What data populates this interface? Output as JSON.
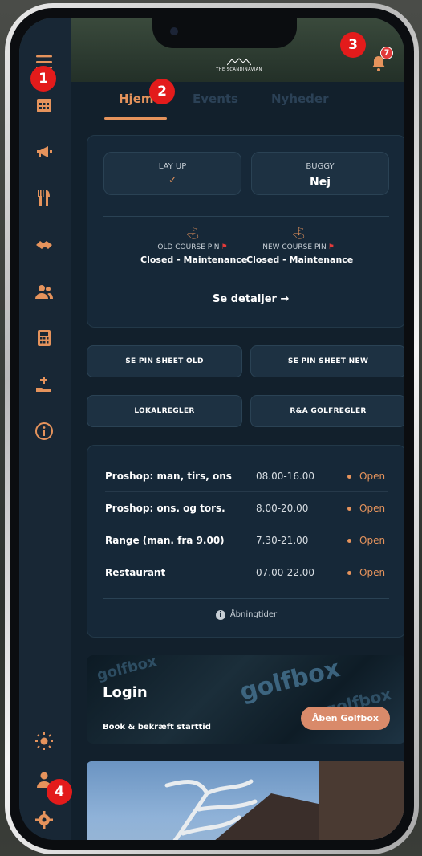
{
  "app": {
    "brand": "THE SCANDINAVIAN",
    "notification_count": "7"
  },
  "tabs": [
    {
      "label": "Hjem",
      "active": true
    },
    {
      "label": "Events",
      "active": false
    },
    {
      "label": "Nyheder",
      "active": false
    }
  ],
  "status": {
    "layup_label": "LAY UP",
    "layup_value": "✓",
    "buggy_label": "BUGGY",
    "buggy_value": "Nej",
    "old_pin_label": "OLD COURSE PIN",
    "old_pin_value": "Closed - Maintenance",
    "new_pin_label": "NEW COURSE PIN",
    "new_pin_value": "Closed - Maintenance",
    "details_link": "Se detaljer →"
  },
  "buttons": {
    "pin_sheet_old": "SE PIN SHEET OLD",
    "pin_sheet_new": "SE PIN SHEET NEW",
    "local_rules": "LOKALREGLER",
    "ra_rules": "R&A GOLFREGLER"
  },
  "opening_hours": {
    "rows": [
      {
        "name": "Proshop: man, tirs, ons",
        "time": "08.00-16.00",
        "status": "Open"
      },
      {
        "name": "Proshop: ons. og tors.",
        "time": "8.00-20.00",
        "status": "Open"
      },
      {
        "name": "Range (man. fra 9.00)",
        "time": "7.30-21.00",
        "status": "Open"
      },
      {
        "name": "Restaurant",
        "time": "07.00-22.00",
        "status": "Open"
      }
    ],
    "footer": "Åbningtider"
  },
  "golfbox": {
    "title": "Login",
    "subtitle": "Book & bekræft starttid",
    "button": "Åben Golfbox",
    "brand_text": "golfbox"
  },
  "markers": [
    "1",
    "2",
    "3",
    "4"
  ],
  "colors": {
    "accent": "#e5935c",
    "background": "#12202c",
    "card": "#162838",
    "badge": "#e23a3a",
    "marker": "#e31b1b"
  },
  "icons": {
    "sidebar": [
      "menu-icon",
      "calendar-icon",
      "megaphone-icon",
      "restaurant-icon",
      "handshake-icon",
      "users-icon",
      "calculator-icon",
      "hand-plus-icon",
      "info-icon",
      "sun-icon",
      "person-icon",
      "settings-icon"
    ],
    "topbar": [
      "bell-icon"
    ]
  }
}
